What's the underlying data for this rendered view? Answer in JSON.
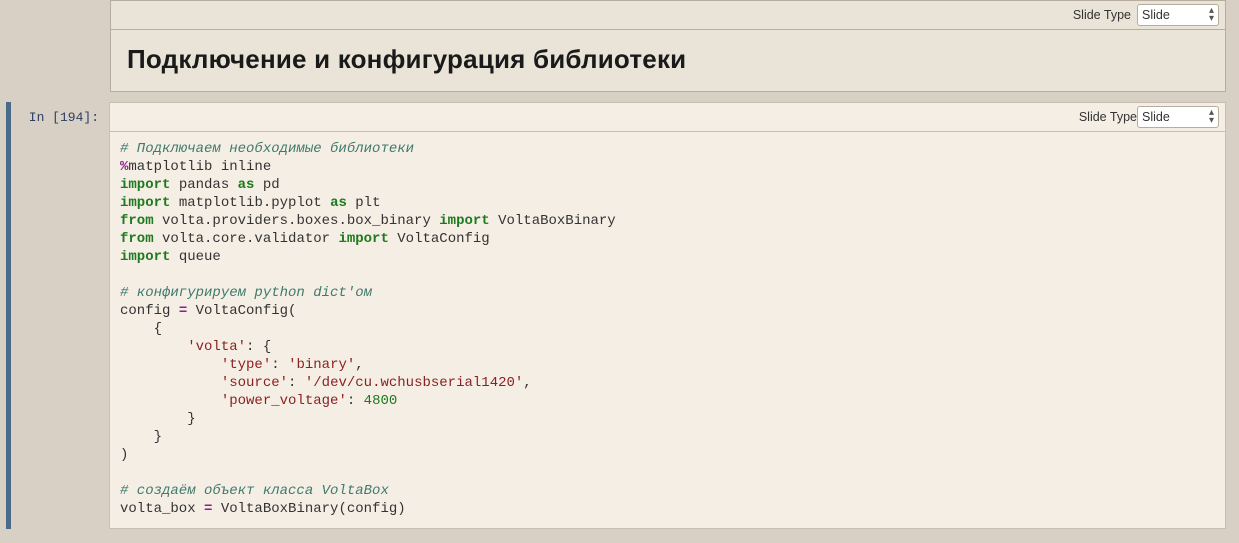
{
  "md_cell": {
    "slide_type_label": "Slide Type",
    "slide_type_value": "Slide",
    "heading": "Подключение и конфигурация библиотеки"
  },
  "code_cell": {
    "slide_type_label": "Slide Type",
    "slide_type_value": "Slide",
    "prompt": "In [194]:",
    "code_tokens": [
      [
        [
          "cm-comment",
          "# Подключаем необходимые библиотеки"
        ]
      ],
      [
        [
          "cm-op",
          "%"
        ],
        [
          "cm-ident",
          "matplotlib inline"
        ]
      ],
      [
        [
          "cm-keyword",
          "import"
        ],
        [
          "",
          " "
        ],
        [
          "cm-ident",
          "pandas"
        ],
        [
          "",
          " "
        ],
        [
          "cm-keyword",
          "as"
        ],
        [
          "",
          " "
        ],
        [
          "cm-ident",
          "pd"
        ]
      ],
      [
        [
          "cm-keyword",
          "import"
        ],
        [
          "",
          " "
        ],
        [
          "cm-ident",
          "matplotlib.pyplot"
        ],
        [
          "",
          " "
        ],
        [
          "cm-keyword",
          "as"
        ],
        [
          "",
          " "
        ],
        [
          "cm-ident",
          "plt"
        ]
      ],
      [
        [
          "cm-keyword",
          "from"
        ],
        [
          "",
          " "
        ],
        [
          "cm-ident",
          "volta.providers.boxes.box_binary"
        ],
        [
          "",
          " "
        ],
        [
          "cm-keyword",
          "import"
        ],
        [
          "",
          " "
        ],
        [
          "cm-ident",
          "VoltaBoxBinary"
        ]
      ],
      [
        [
          "cm-keyword",
          "from"
        ],
        [
          "",
          " "
        ],
        [
          "cm-ident",
          "volta.core.validator"
        ],
        [
          "",
          " "
        ],
        [
          "cm-keyword",
          "import"
        ],
        [
          "",
          " "
        ],
        [
          "cm-ident",
          "VoltaConfig"
        ]
      ],
      [
        [
          "cm-keyword",
          "import"
        ],
        [
          "",
          " "
        ],
        [
          "cm-ident",
          "queue"
        ]
      ],
      [
        [
          "",
          ""
        ]
      ],
      [
        [
          "cm-comment",
          "# конфигурируем python dict'ом"
        ]
      ],
      [
        [
          "cm-ident",
          "config "
        ],
        [
          "cm-op",
          "="
        ],
        [
          "",
          " "
        ],
        [
          "cm-ident",
          "VoltaConfig("
        ]
      ],
      [
        [
          "",
          "    "
        ],
        [
          "cm-ident",
          "{"
        ]
      ],
      [
        [
          "",
          "        "
        ],
        [
          "cm-string",
          "'volta'"
        ],
        [
          "cm-ident",
          ": {"
        ]
      ],
      [
        [
          "",
          "            "
        ],
        [
          "cm-string",
          "'type'"
        ],
        [
          "cm-ident",
          ": "
        ],
        [
          "cm-string",
          "'binary'"
        ],
        [
          "cm-ident",
          ","
        ]
      ],
      [
        [
          "",
          "            "
        ],
        [
          "cm-string",
          "'source'"
        ],
        [
          "cm-ident",
          ": "
        ],
        [
          "cm-string",
          "'/dev/cu.wchusbserial1420'"
        ],
        [
          "cm-ident",
          ","
        ]
      ],
      [
        [
          "",
          "            "
        ],
        [
          "cm-string",
          "'power_voltage'"
        ],
        [
          "cm-ident",
          ": "
        ],
        [
          "cm-number",
          "4800"
        ]
      ],
      [
        [
          "",
          "        "
        ],
        [
          "cm-ident",
          "}"
        ]
      ],
      [
        [
          "",
          "    "
        ],
        [
          "cm-ident",
          "}"
        ]
      ],
      [
        [
          "cm-ident",
          ")"
        ]
      ],
      [
        [
          "",
          ""
        ]
      ],
      [
        [
          "cm-comment",
          "# создаём объект класса VoltaBox"
        ]
      ],
      [
        [
          "cm-ident",
          "volta_box "
        ],
        [
          "cm-op",
          "="
        ],
        [
          "",
          " "
        ],
        [
          "cm-ident",
          "VoltaBoxBinary(config)"
        ]
      ]
    ]
  }
}
